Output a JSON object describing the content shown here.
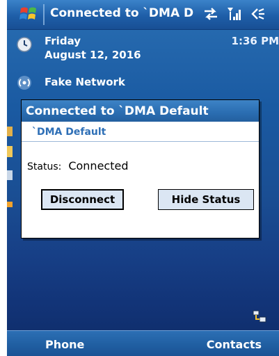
{
  "titlebar": {
    "title": "Connected to `DMA D",
    "icons": [
      "windows-flag-icon",
      "connection-arrows-icon",
      "signal-strength-icon",
      "speaker-icon"
    ]
  },
  "today": {
    "day": "Friday",
    "date": "August 12, 2016",
    "time": "1:36 PM",
    "network": "Fake Network"
  },
  "dialog": {
    "title": "Connected to `DMA Default",
    "network_name": "`DMA Default",
    "status_label": "Status:",
    "status_value": "Connected",
    "disconnect_label": "Disconnect",
    "hide_status_label": "Hide Status"
  },
  "softkeys": {
    "left": "Phone",
    "right": "Contacts"
  },
  "colors": {
    "title_bar": "#1e5ea8",
    "dialog_accent": "#2e6fb6",
    "button_bg": "#dbe6f3"
  }
}
